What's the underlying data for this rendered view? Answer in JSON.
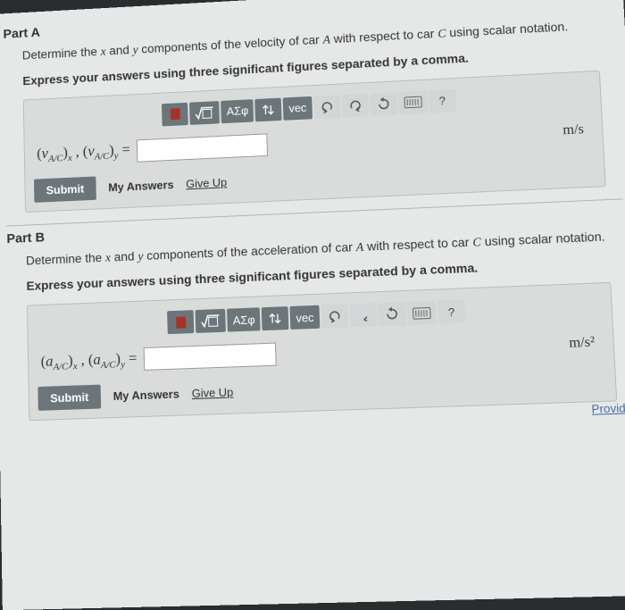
{
  "partA": {
    "label": "Part A",
    "prompt_pre": "Determine the ",
    "var1": "x",
    "prompt_mid1": " and ",
    "var2": "y",
    "prompt_mid2": " components of the velocity of car ",
    "var3": "A",
    "prompt_mid3": " with respect to car ",
    "var4": "C",
    "prompt_post": " using scalar notation.",
    "instructions": "Express your answers using three significant figures separated by a comma.",
    "expr_html": "(v<sub>A/C</sub>)<sub>x</sub>, (v<sub>A/C</sub>)<sub>y</sub> =",
    "units": "m/s",
    "submit": "Submit",
    "my_answers": "My Answers",
    "give_up": "Give Up"
  },
  "partB": {
    "label": "Part B",
    "prompt_pre": "Determine the ",
    "var1": "x",
    "prompt_mid1": " and ",
    "var2": "y",
    "prompt_mid2": " components of the acceleration of car ",
    "var3": "A",
    "prompt_mid3": " with respect to car ",
    "var4": "C",
    "prompt_post": " using scalar notation.",
    "instructions": "Express your answers using three significant figures separated by a comma.",
    "expr_html": "(a<sub>A/C</sub>)<sub>x</sub>, (a<sub>A/C</sub>)<sub>y</sub> =",
    "units": "m/s²",
    "submit": "Submit",
    "my_answers": "My Answers",
    "give_up": "Give Up"
  },
  "toolbar": {
    "greek": "ΑΣφ",
    "vec": "vec",
    "help": "?"
  },
  "footer": {
    "provide": "Provide"
  }
}
